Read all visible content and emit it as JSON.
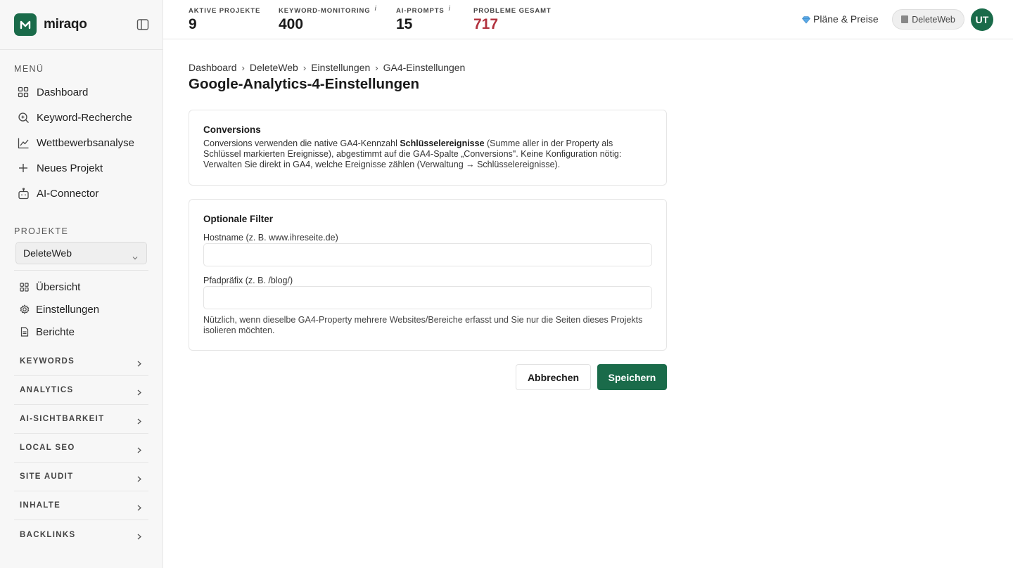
{
  "app": {
    "name": "miraqo",
    "brand_color": "#1a6b4a"
  },
  "sidebar": {
    "menu_label": "MENÜ",
    "menu_items": [
      {
        "label": "Dashboard",
        "icon": "grid-icon"
      },
      {
        "label": "Keyword-Recherche",
        "icon": "search-icon"
      },
      {
        "label": "Wettbewerbsanalyse",
        "icon": "line-chart-icon"
      },
      {
        "label": "Neues Projekt",
        "icon": "plus-icon"
      },
      {
        "label": "AI-Connector",
        "icon": "robot-icon"
      }
    ],
    "projects_label": "PROJEKTE",
    "selected_project": "DeleteWeb",
    "project_items": [
      {
        "label": "Übersicht",
        "icon": "grid-icon"
      },
      {
        "label": "Einstellungen",
        "icon": "gear-icon"
      },
      {
        "label": "Berichte",
        "icon": "document-icon"
      }
    ],
    "groups": [
      {
        "label": "KEYWORDS"
      },
      {
        "label": "ANALYTICS"
      },
      {
        "label": "AI-SICHTBARKEIT"
      },
      {
        "label": "LOCAL SEO"
      },
      {
        "label": "SITE AUDIT"
      },
      {
        "label": "INHALTE"
      },
      {
        "label": "BACKLINKS"
      }
    ]
  },
  "topbar": {
    "stats": [
      {
        "label": "AKTIVE PROJEKTE",
        "value": "9",
        "info": ""
      },
      {
        "label": "KEYWORD-MONITORING",
        "value": "400",
        "info": "i"
      },
      {
        "label": "AI-PROMPTS",
        "value": "15",
        "info": "i"
      },
      {
        "label": "PROBLEME GESAMT",
        "value": "717",
        "info": ""
      }
    ],
    "plans_label": "Pläne & Preise",
    "project_chip": "DeleteWeb",
    "avatar_initials": "UT",
    "problem_color": "#b2323e"
  },
  "main": {
    "breadcrumb": [
      "Dashboard",
      "DeleteWeb",
      "Einstellungen",
      "GA4-Einstellungen"
    ],
    "breadcrumb_sep": "›",
    "title": "Google-Analytics-4-Einstellungen",
    "conversions": {
      "heading": "Conversions",
      "text_before": "Conversions verwenden die native GA4-Kennzahl ",
      "text_bold": "Schlüsselereignisse",
      "text_after": " (Summe aller in der Property als Schlüssel markierten Ereignisse), abgestimmt auf die GA4-Spalte „Conversions\". Keine Konfiguration nötig: Verwalten Sie direkt in GA4, welche Ereignisse zählen (Verwaltung → Schlüsselereignisse)."
    },
    "filters": {
      "heading": "Optionale Filter",
      "hostname_label": "Hostname (z. B. www.ihreseite.de)",
      "hostname_value": "",
      "path_label": "Pfadpräfix (z. B. /blog/)",
      "path_value": "",
      "hint": "Nützlich, wenn dieselbe GA4-Property mehrere Websites/Bereiche erfasst und Sie nur die Seiten dieses Projekts isolieren möchten."
    },
    "cancel_label": "Abbrechen",
    "save_label": "Speichern"
  }
}
